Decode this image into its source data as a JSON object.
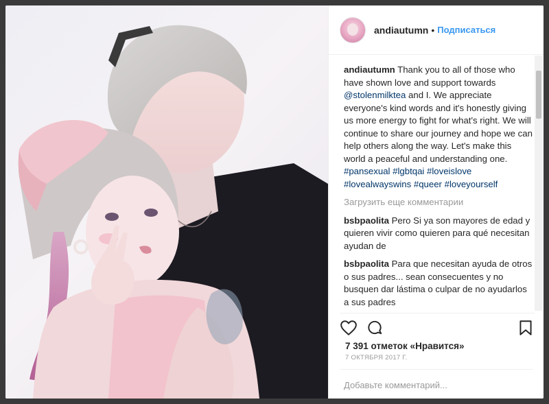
{
  "post": {
    "username": "andiautumn",
    "separator": "•",
    "follow_label": "Подписаться"
  },
  "caption": {
    "username": "andiautumn",
    "text_1": "Thank you to all of those who have shown love and support towards",
    "mention": "@stolenmilktea",
    "text_2": "and I. We appreciate everyone's kind words and it's honestly giving us more energy to fight for what's right. We will continue to share our journey and hope we can help others along the way. Let's make this world a peaceful and understanding one.",
    "hashtags": [
      "#pansexual",
      "#lgbtqai",
      "#loveislove",
      "#lovealwayswins",
      "#queer",
      "#loveyourself"
    ]
  },
  "load_more_label": "Загрузить еще комментарии",
  "comments": [
    {
      "username": "bsbpaolita",
      "text": "Pero Si ya son mayores de edad y quieren vivir como quieren para qué necesitan ayudan de"
    },
    {
      "username": "bsbpaolita",
      "text": "Para que necesitan ayuda de otros o sus padres... sean consecuentes y no busquen dar lástima o culpar de no ayudarlos a sus padres"
    }
  ],
  "likes_text": "7 391 отметок «Нравится»",
  "date_text": "7 ОКТЯБРЯ 2017 Г.",
  "add_comment_placeholder": "Добавьте комментарий...",
  "icons": {
    "like": "heart-icon",
    "comment": "speech-bubble-icon",
    "save": "bookmark-icon"
  },
  "colors": {
    "link": "#003569",
    "follow": "#3897f0",
    "text": "#262626",
    "muted": "#999999"
  }
}
